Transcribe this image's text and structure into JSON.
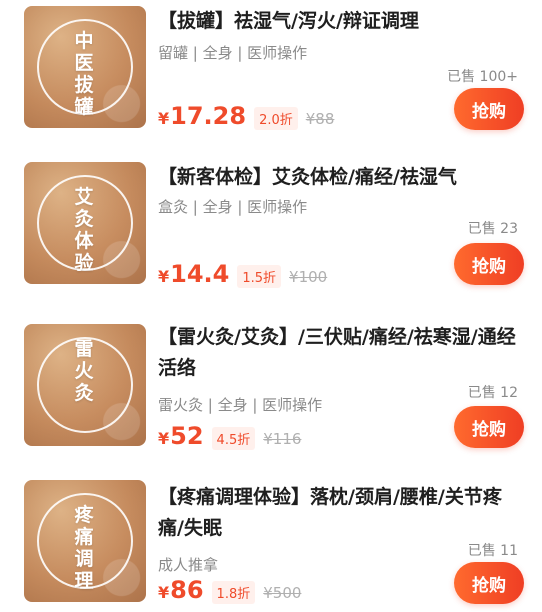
{
  "items": [
    {
      "thumb_text": "中医拔罐",
      "name": "【拔罐】祛湿气/泻火/辩证调理",
      "tags": "留罐 | 全身 | 医师操作",
      "sold": "已售 100+",
      "price_symbol": "¥",
      "price": "17.28",
      "discount": "2.0折",
      "original_price": "¥88",
      "buy_label": "抢购"
    },
    {
      "thumb_text": "艾灸体验",
      "name": "【新客体检】艾灸体检/痛经/祛湿气",
      "tags": "盒灸 | 全身 | 医师操作",
      "sold": "已售 23",
      "price_symbol": "¥",
      "price": "14.4",
      "discount": "1.5折",
      "original_price": "¥100",
      "buy_label": "抢购"
    },
    {
      "thumb_text": "雷火灸",
      "name": "【雷火灸/艾灸】/三伏贴/痛经/祛寒湿/通经活络",
      "tags": "雷火灸 | 全身 | 医师操作",
      "sold": "已售 12",
      "price_symbol": "¥",
      "price": "52",
      "discount": "4.5折",
      "original_price": "¥116",
      "buy_label": "抢购"
    },
    {
      "thumb_text": "疼痛调理",
      "name": "【疼痛调理体验】落枕/颈肩/腰椎/关节疼痛/失眠",
      "tags": "成人推拿",
      "sold": "已售 11",
      "price_symbol": "¥",
      "price": "86",
      "discount": "1.8折",
      "original_price": "¥500",
      "buy_label": "抢购"
    }
  ],
  "colors": {
    "accent": "#ef4b2b",
    "button_gradient_start": "#ff6a2e",
    "button_gradient_end": "#ef3e24",
    "thumb": "#c98b5b"
  }
}
